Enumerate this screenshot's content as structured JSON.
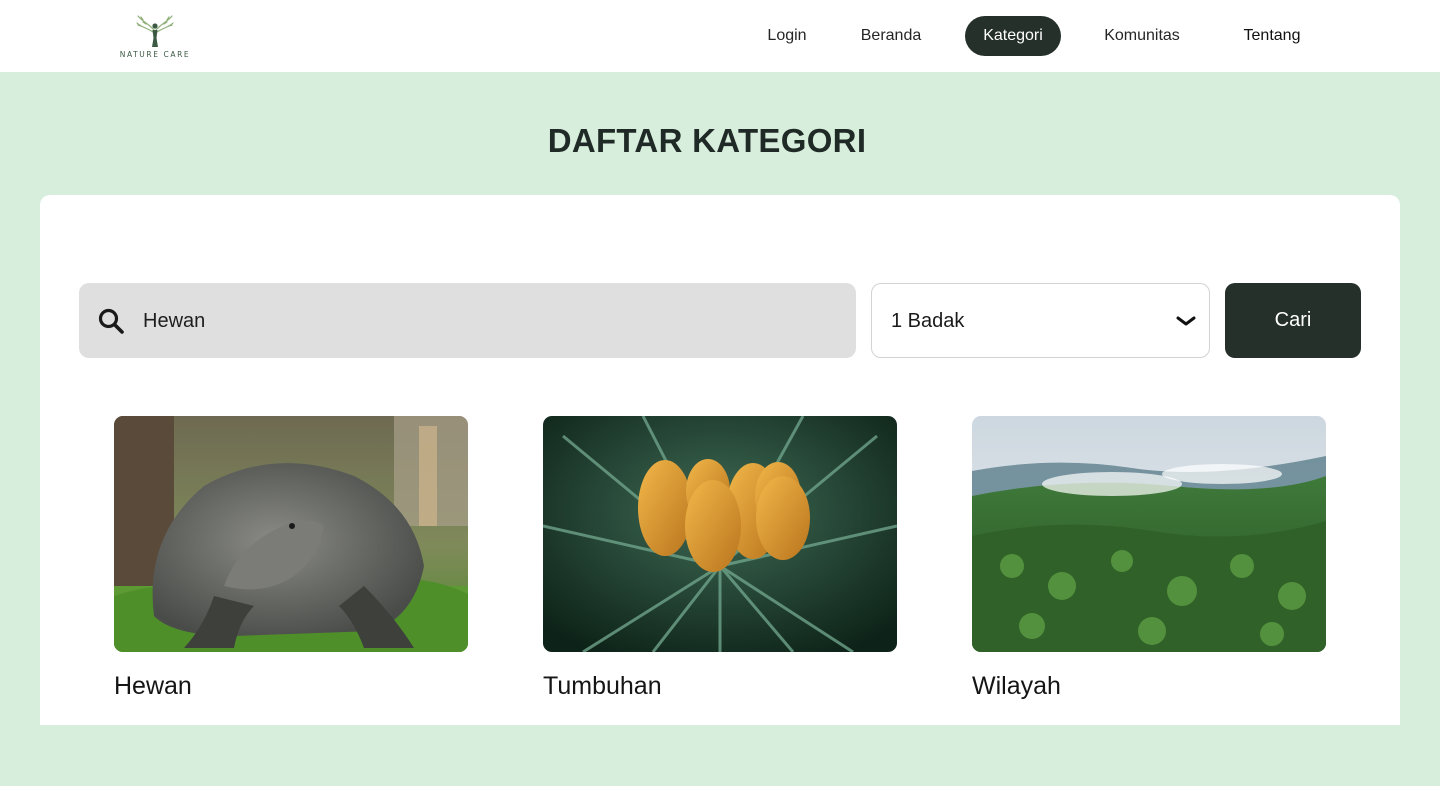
{
  "brand": {
    "logo_text": "NATURE CARE",
    "logo_icon": "angel-tree-logo-icon",
    "accent": "#243029",
    "background": "#d8eedd"
  },
  "nav": {
    "login": "Login",
    "beranda": "Beranda",
    "kategori": "Kategori",
    "komunitas": "Komunitas",
    "tentang": "Tentang",
    "active": "Kategori"
  },
  "page": {
    "title": "DAFTAR KATEGORI"
  },
  "search": {
    "value": "Hewan",
    "placeholder": "",
    "icon": "search-icon"
  },
  "filter": {
    "selected": "1 Badak",
    "icon": "chevron-down-icon"
  },
  "actions": {
    "search_button": "Cari"
  },
  "categories": [
    {
      "label": "Hewan",
      "image": "komodo-dragon-photo"
    },
    {
      "label": "Tumbuhan",
      "image": "cycad-cones-photo"
    },
    {
      "label": "Wilayah",
      "image": "rainforest-aerial-photo"
    }
  ]
}
